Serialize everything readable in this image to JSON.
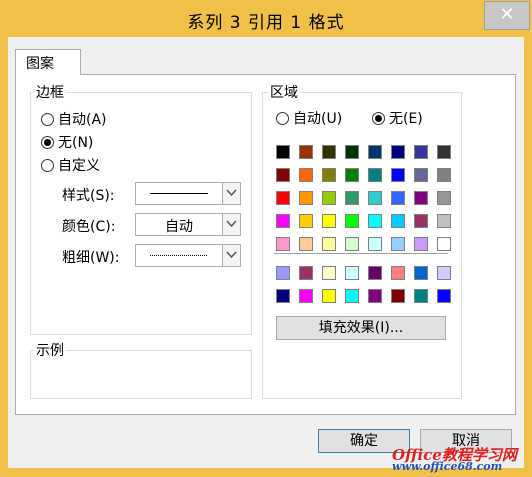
{
  "window": {
    "title": "系列 3 引用 1 格式",
    "close_label": "✕"
  },
  "tabs": [
    {
      "label": "图案"
    }
  ],
  "border": {
    "group_label": "边框",
    "options": [
      {
        "label": "自动(A)",
        "checked": false
      },
      {
        "label": "无(N)",
        "checked": true
      },
      {
        "label": "自定义",
        "checked": false
      }
    ],
    "style_label": "样式(S):",
    "color_label": "颜色(C):",
    "color_value": "自动",
    "weight_label": "粗细(W):"
  },
  "sample": {
    "group_label": "示例"
  },
  "area": {
    "group_label": "区域",
    "options": [
      {
        "label": "自动(U)",
        "checked": false
      },
      {
        "label": "无(E)",
        "checked": true
      }
    ],
    "palette_main": [
      [
        "#000000",
        "#993300",
        "#333300",
        "#003300",
        "#003366",
        "#000080",
        "#333399",
        "#333333"
      ],
      [
        "#800000",
        "#ff6600",
        "#808000",
        "#008000",
        "#008080",
        "#0000ff",
        "#666699",
        "#808080"
      ],
      [
        "#ff0000",
        "#ff9900",
        "#99cc00",
        "#339966",
        "#33cccc",
        "#3366ff",
        "#800080",
        "#969696"
      ],
      [
        "#ff00ff",
        "#ffcc00",
        "#ffff00",
        "#00ff00",
        "#00ffff",
        "#00ccff",
        "#993366",
        "#c0c0c0"
      ],
      [
        "#ff99cc",
        "#ffcc99",
        "#ffff99",
        "#ccffcc",
        "#ccffff",
        "#99ccff",
        "#cc99ff",
        "#ffffff"
      ]
    ],
    "palette_extra": [
      [
        "#9999ff",
        "#993366",
        "#ffffcc",
        "#ccffff",
        "#660066",
        "#ff8080",
        "#0066cc",
        "#ccccff"
      ],
      [
        "#000080",
        "#ff00ff",
        "#ffff00",
        "#00ffff",
        "#800080",
        "#800000",
        "#008080",
        "#0000ff"
      ]
    ],
    "fill_effects_label": "填充效果(I)..."
  },
  "footer": {
    "ok_label": "确定",
    "cancel_label": "取消"
  },
  "watermark": {
    "text1": "Office教程学习网",
    "text2": "www.office68.com"
  }
}
